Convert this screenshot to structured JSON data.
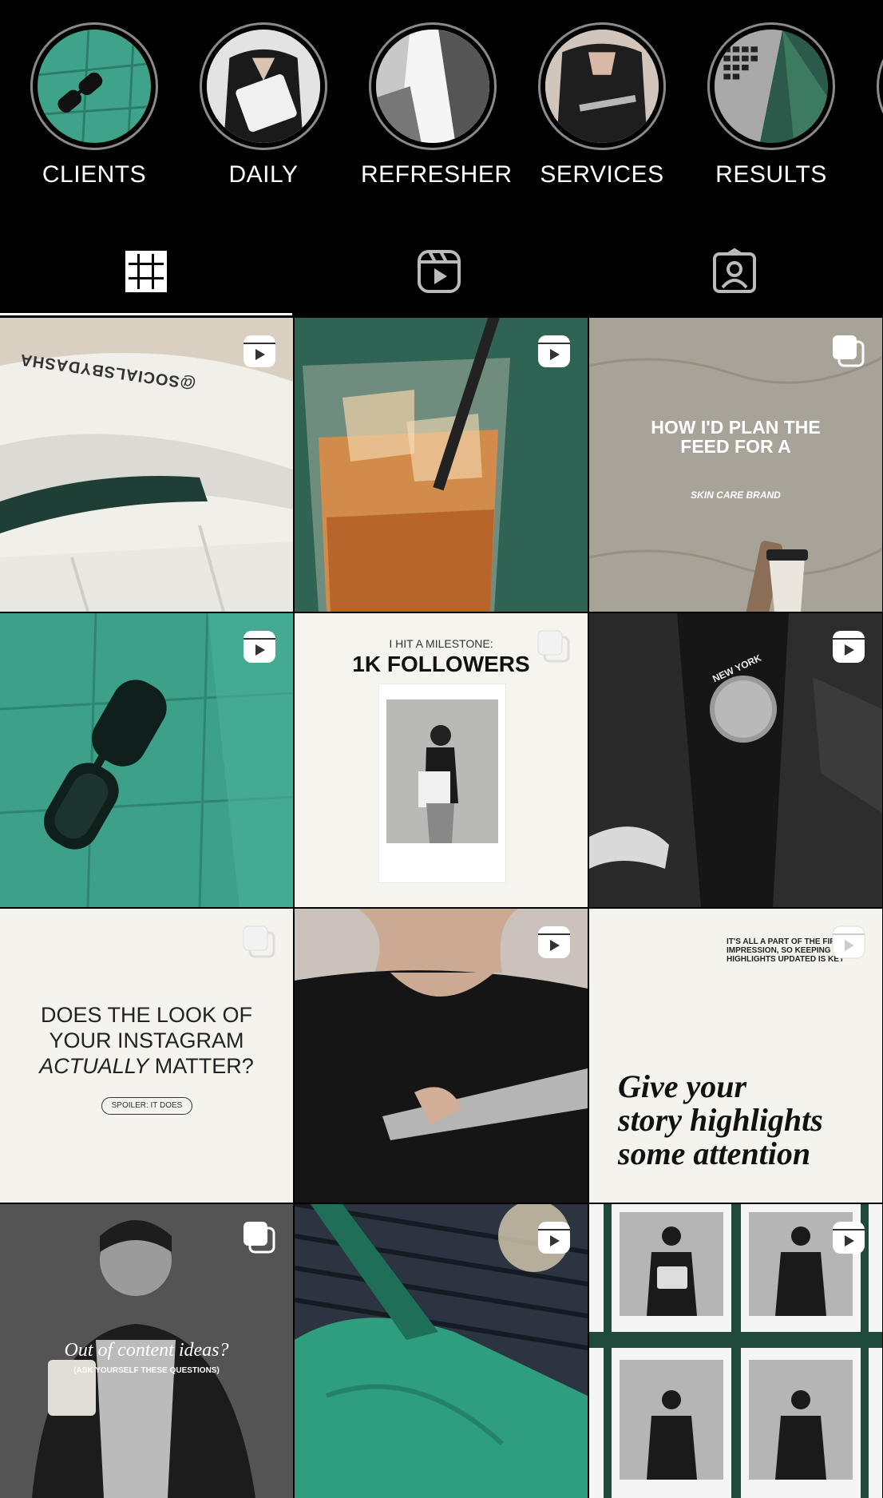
{
  "highlights": [
    {
      "label": "CLIENTS"
    },
    {
      "label": "DAILY"
    },
    {
      "label": "REFRESHER"
    },
    {
      "label": "SERVICES"
    },
    {
      "label": "RESULTS"
    }
  ],
  "tabs": [
    {
      "icon": "grid-icon",
      "active": true
    },
    {
      "icon": "reels-icon",
      "active": false
    },
    {
      "icon": "tagged-icon",
      "active": false
    }
  ],
  "posts": [
    {
      "type": "reel",
      "text": {
        "brand": "@SOCIALSBYDASHA"
      }
    },
    {
      "type": "reel"
    },
    {
      "type": "carousel",
      "text": {
        "title": "HOW I'D PLAN THE FEED FOR A",
        "subtitle": "SKIN CARE BRAND"
      }
    },
    {
      "type": "reel"
    },
    {
      "type": "carousel",
      "text": {
        "kicker": "I HIT A MILESTONE:",
        "title": "1K FOLLOWERS"
      }
    },
    {
      "type": "reel",
      "text": {
        "patch": "NEW YORK"
      }
    },
    {
      "type": "carousel",
      "text": {
        "line1": "DOES THE LOOK OF",
        "line2": "YOUR INSTAGRAM",
        "line3a": "ACTUALLY",
        "line3b": " MATTER?",
        "pill": "SPOILER: IT DOES"
      }
    },
    {
      "type": "reel"
    },
    {
      "type": "reel",
      "text": {
        "small1": "IT'S ALL A PART OF THE FIRST",
        "small2": "IMPRESSION, SO KEEPING YOUR",
        "small3": "HIGHLIGHTS UPDATED IS KEY",
        "big1": "Give your",
        "big2": "story highlights",
        "big3": "some attention"
      }
    },
    {
      "type": "carousel",
      "text": {
        "title": "Out of content ideas?",
        "subtitle": "(ASK YOURSELF THESE QUESTIONS)"
      }
    },
    {
      "type": "reel"
    },
    {
      "type": "reel"
    }
  ],
  "colors": {
    "accent_green": "#2e8c73",
    "dark_green": "#1f4a3c",
    "cream": "#f4f2ea",
    "background": "#000000"
  }
}
